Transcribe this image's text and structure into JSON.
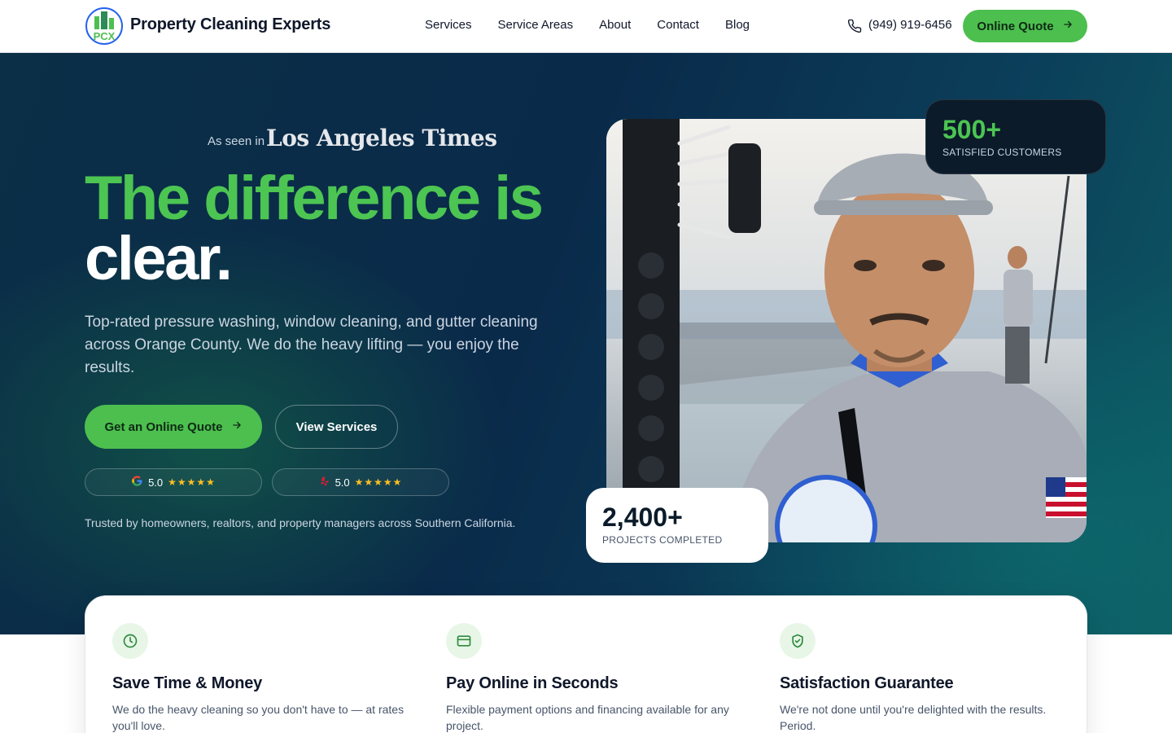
{
  "header": {
    "brand": "Property Cleaning Experts",
    "logo_text": "PCX",
    "nav": [
      "Services",
      "Service Areas",
      "About",
      "Contact",
      "Blog"
    ],
    "phone": "(949) 919-6456",
    "quote_label": "Online Quote"
  },
  "hero": {
    "as_seen_in": "As seen in",
    "publication": "Los Angeles Times",
    "headline_line1": "The difference is",
    "headline_line2": "clear.",
    "subheadline": "Top-rated pressure washing, window cleaning, and gutter cleaning across Orange County. We do the heavy lifting — you enjoy the results.",
    "primary_cta": "Get an Online Quote",
    "secondary_cta": "View Services",
    "ratings": [
      {
        "source_icon": "google-icon",
        "score": "5.0",
        "stars": "★★★★★"
      },
      {
        "source_icon": "yelp-icon",
        "score": "5.0",
        "stars": "★★★★★"
      }
    ],
    "trusted": "Trusted by homeowners, realtors, and property managers across Southern California.",
    "stats": [
      {
        "number": "500+",
        "label": "SATISFIED CUSTOMERS"
      },
      {
        "number": "2,400+",
        "label": "PROJECTS COMPLETED"
      }
    ]
  },
  "features": [
    {
      "icon": "clock-icon",
      "title": "Save Time & Money",
      "desc": "We do the heavy cleaning so you don't have to — at rates you'll love."
    },
    {
      "icon": "credit-card-icon",
      "title": "Pay Online in Seconds",
      "desc": "Flexible payment options and financing available for any project."
    },
    {
      "icon": "shield-check-icon",
      "title": "Satisfaction Guarantee",
      "desc": "We're not done until you're delighted with the results. Period."
    }
  ],
  "colors": {
    "accent": "#4cbf4f",
    "hero_bg": "#0a2a4a",
    "dark_card": "#0b1b2a"
  }
}
